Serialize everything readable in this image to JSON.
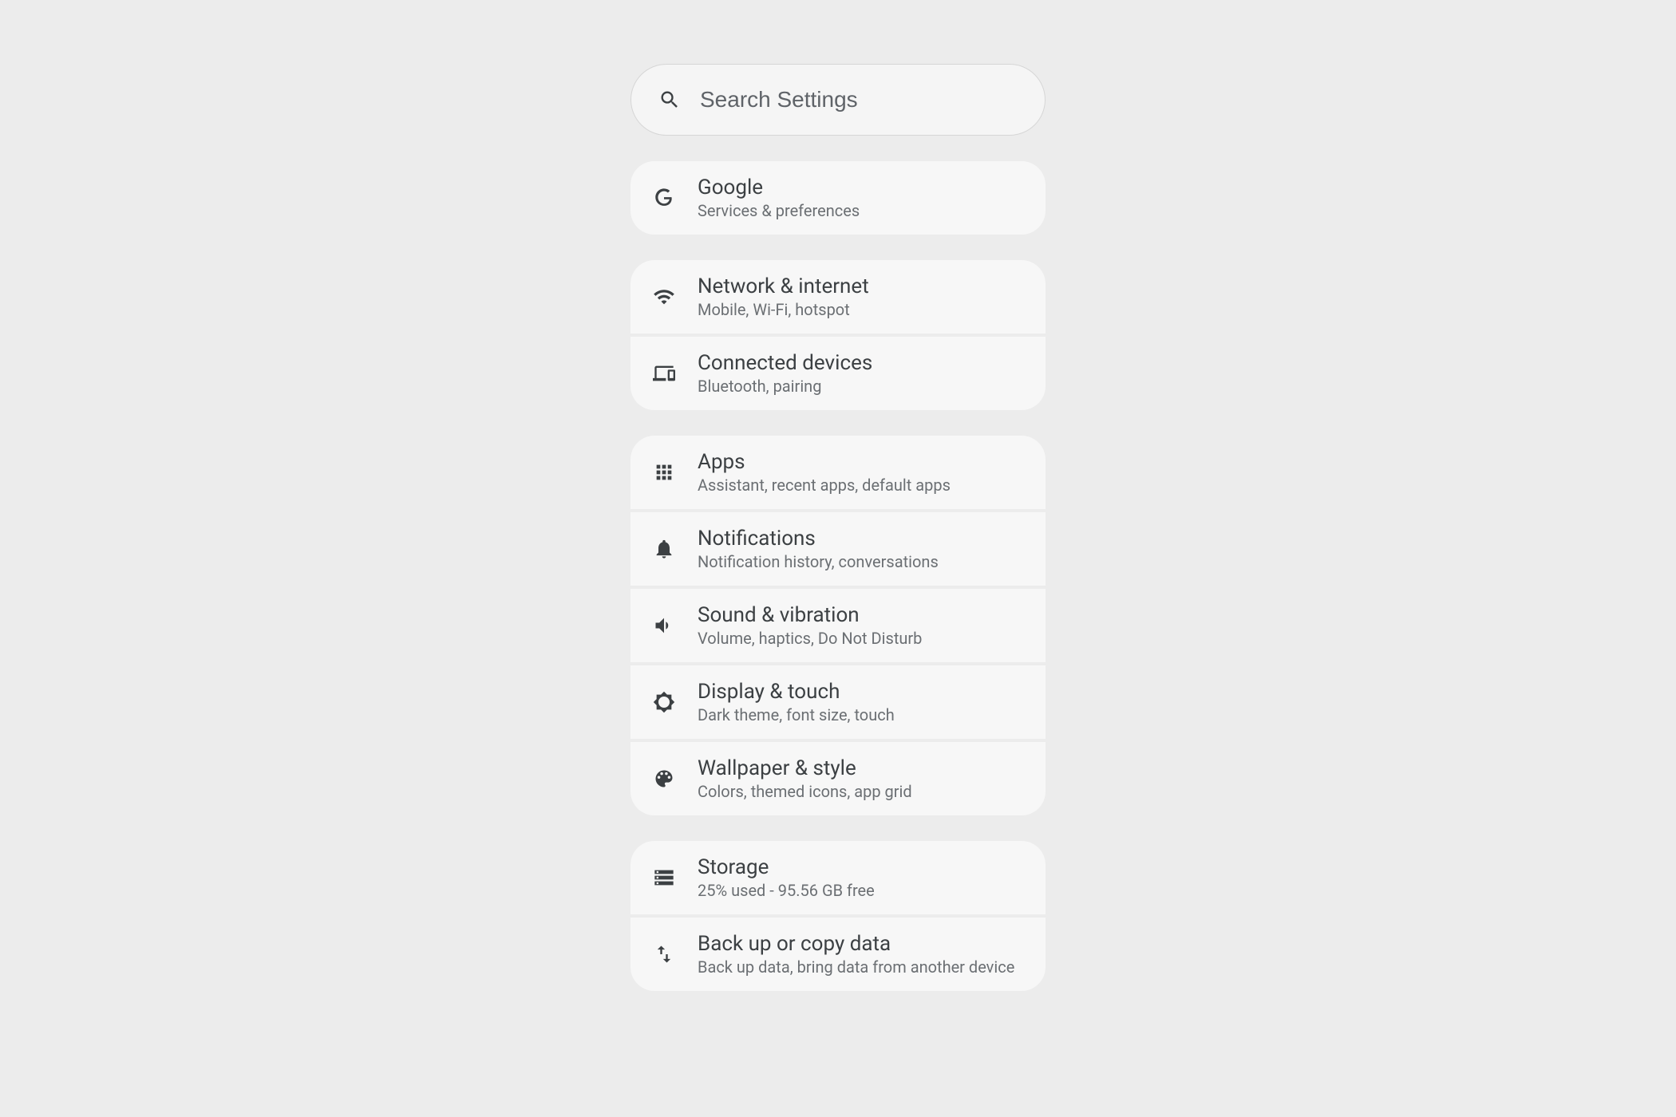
{
  "search": {
    "placeholder": "Search Settings"
  },
  "groups": [
    [
      {
        "id": "google",
        "title": "Google",
        "sub": "Services & preferences"
      }
    ],
    [
      {
        "id": "network",
        "title": "Network & internet",
        "sub": "Mobile, Wi-Fi, hotspot"
      },
      {
        "id": "connected",
        "title": "Connected devices",
        "sub": "Bluetooth, pairing"
      }
    ],
    [
      {
        "id": "apps",
        "title": "Apps",
        "sub": "Assistant, recent apps, default apps"
      },
      {
        "id": "notifications",
        "title": "Notifications",
        "sub": "Notification history, conversations"
      },
      {
        "id": "sound",
        "title": "Sound & vibration",
        "sub": "Volume, haptics, Do Not Disturb"
      },
      {
        "id": "display",
        "title": "Display & touch",
        "sub": "Dark theme, font size, touch"
      },
      {
        "id": "wallpaper",
        "title": "Wallpaper & style",
        "sub": "Colors, themed icons, app grid"
      }
    ],
    [
      {
        "id": "storage",
        "title": "Storage",
        "sub": "25% used - 95.56 GB free"
      },
      {
        "id": "backup",
        "title": "Back up or copy data",
        "sub": "Back up data, bring data from another device"
      }
    ]
  ]
}
